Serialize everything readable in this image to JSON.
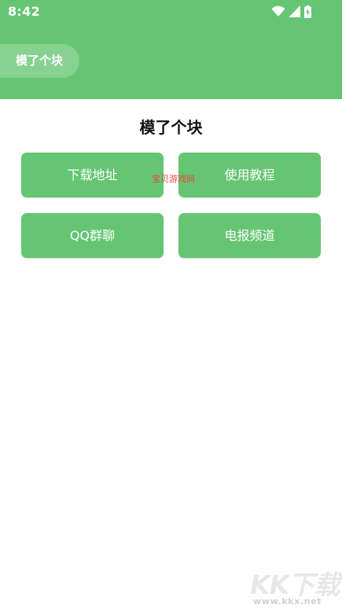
{
  "status_bar": {
    "time": "8:42"
  },
  "header": {
    "chip_label": "模了个块"
  },
  "main": {
    "title": "模了个块",
    "buttons": [
      {
        "label": "下载地址"
      },
      {
        "label": "使用教程"
      },
      {
        "label": "QQ群聊"
      },
      {
        "label": "电报频道"
      }
    ]
  },
  "watermarks": {
    "overlay_text": "宝贝游戏网",
    "logo_text": "KK下载",
    "site_url": "www.kkx.net"
  },
  "colors": {
    "primary": "#66c573",
    "background": "#ffffff",
    "title_text": "#111111",
    "watermark_red": "#e8483a"
  },
  "icons": [
    "wifi-icon",
    "cellular-signal-icon",
    "battery-charging-icon"
  ]
}
